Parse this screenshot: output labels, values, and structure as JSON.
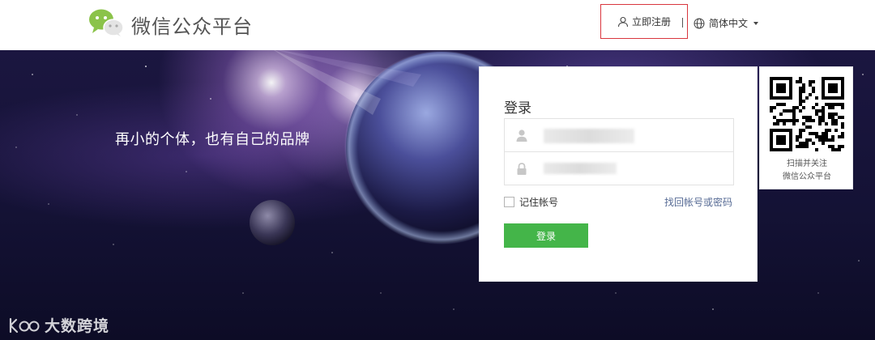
{
  "header": {
    "brand": "微信公众平台",
    "register_label": "立即注册",
    "language_label": "简体中文"
  },
  "hero": {
    "tagline": "再小的个体，也有自己的品牌"
  },
  "login": {
    "title": "登录",
    "remember_label": "记住帐号",
    "forgot_label": "找回帐号或密码",
    "submit_label": "登录"
  },
  "qr": {
    "line1": "扫描并关注",
    "line2": "微信公众平台"
  },
  "watermark": {
    "text": "大数跨境"
  },
  "colors": {
    "accent_green": "#44b549",
    "link_blue": "#576b95",
    "highlight_red": "#d9363e",
    "logo_green": "#8bc34a"
  },
  "icons": {
    "logo": "wechat-logo-icon",
    "register": "user-icon",
    "language": "globe-icon",
    "account": "person-icon",
    "password": "lock-icon"
  }
}
